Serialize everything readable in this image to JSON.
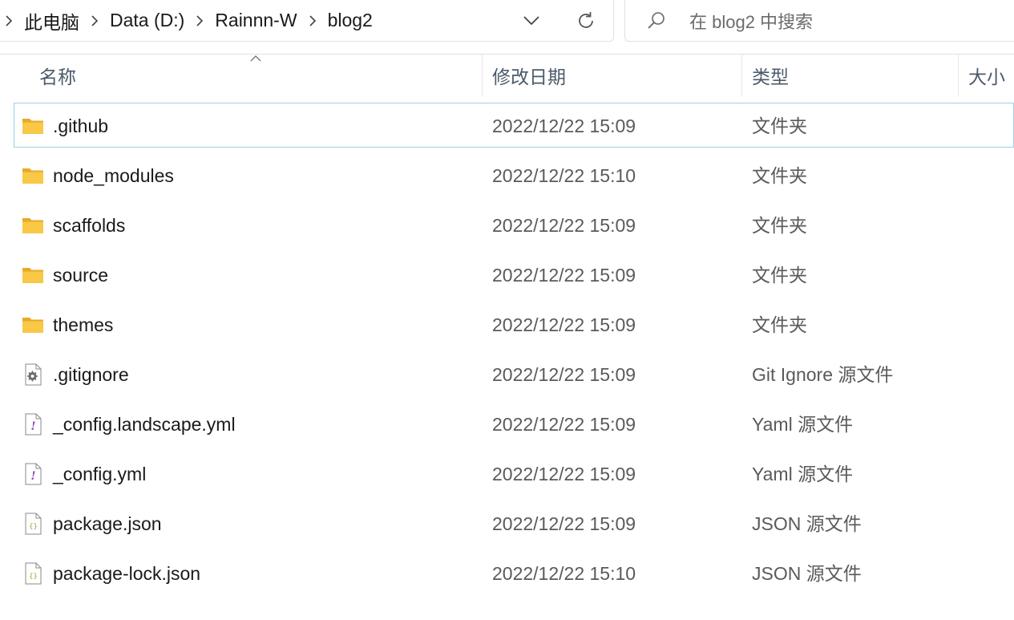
{
  "address": {
    "breadcrumbs": [
      "此电脑",
      "Data (D:)",
      "Rainnn-W",
      "blog2"
    ]
  },
  "search": {
    "placeholder": "在 blog2 中搜索"
  },
  "columns": {
    "name": "名称",
    "date": "修改日期",
    "type": "类型",
    "size": "大小"
  },
  "icons": {
    "folder": "folder-icon",
    "gitignore": "settings-file-icon",
    "yaml": "yaml-file-icon",
    "json": "json-file-icon"
  },
  "colors": {
    "selection_border": "#99d1e6",
    "folder_yellow": "#f8c846",
    "yaml_purple": "#8a4bb8",
    "json_green": "#9aa93a"
  },
  "files": [
    {
      "name": ".github",
      "date": "2022/12/22 15:09",
      "type": "文件夹",
      "icon": "folder"
    },
    {
      "name": "node_modules",
      "date": "2022/12/22 15:10",
      "type": "文件夹",
      "icon": "folder"
    },
    {
      "name": "scaffolds",
      "date": "2022/12/22 15:09",
      "type": "文件夹",
      "icon": "folder"
    },
    {
      "name": "source",
      "date": "2022/12/22 15:09",
      "type": "文件夹",
      "icon": "folder"
    },
    {
      "name": "themes",
      "date": "2022/12/22 15:09",
      "type": "文件夹",
      "icon": "folder"
    },
    {
      "name": ".gitignore",
      "date": "2022/12/22 15:09",
      "type": "Git Ignore 源文件",
      "icon": "gitignore"
    },
    {
      "name": "_config.landscape.yml",
      "date": "2022/12/22 15:09",
      "type": "Yaml 源文件",
      "icon": "yaml"
    },
    {
      "name": "_config.yml",
      "date": "2022/12/22 15:09",
      "type": "Yaml 源文件",
      "icon": "yaml"
    },
    {
      "name": "package.json",
      "date": "2022/12/22 15:09",
      "type": "JSON 源文件",
      "icon": "json"
    },
    {
      "name": "package-lock.json",
      "date": "2022/12/22 15:10",
      "type": "JSON 源文件",
      "icon": "json"
    }
  ]
}
